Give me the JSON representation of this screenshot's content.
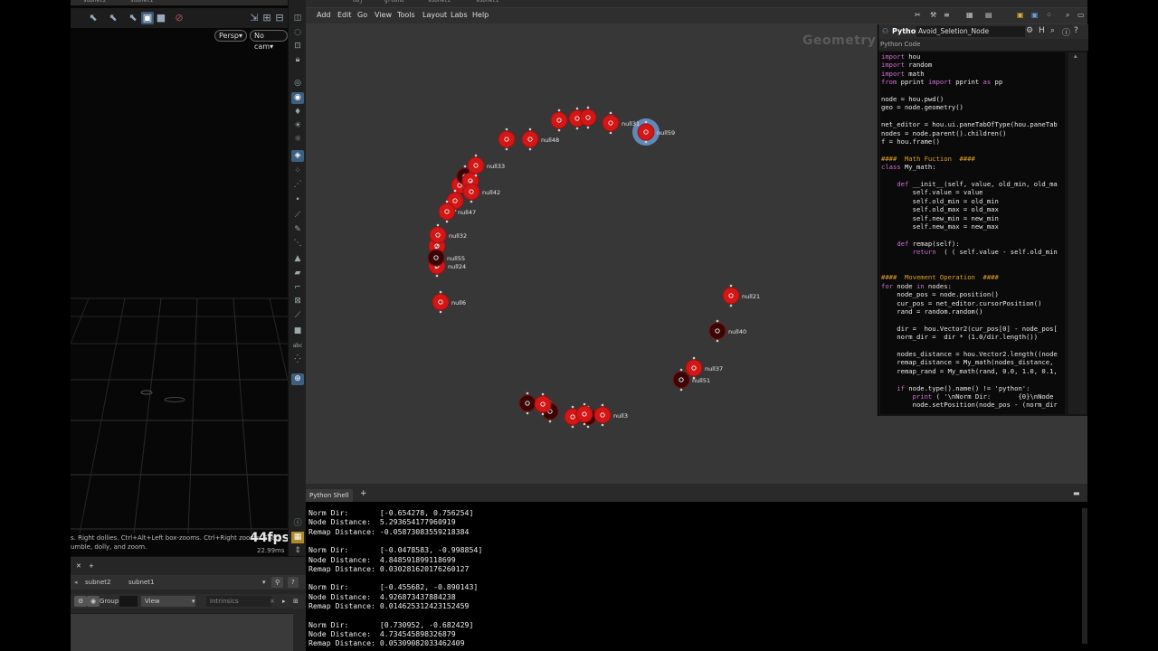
{
  "viewport": {
    "persp_label": "Persp▾",
    "cam_label": "No cam▾",
    "status_lines": [
      "s. Right dollies. Ctrl+Alt+Left box-zooms. Ctrl+Right zooms. Spac",
      "umble, dolly, and zoom."
    ],
    "fps": "44fps",
    "ms": "22.99ms"
  },
  "param_pane": {
    "path_items": [
      "subnet2",
      "subnet1"
    ],
    "group_label": "Group:",
    "view_label": "View",
    "intrinsics_label": "Intrinsics"
  },
  "top_paths": [
    "subnet2",
    "subnet1",
    "obj",
    "ground",
    "subnet2",
    "subnet1"
  ],
  "network": {
    "menu": [
      "Add",
      "Edit",
      "Go",
      "View",
      "Tools",
      "Layout",
      "Labs",
      "Help"
    ],
    "context_label": "Geometry",
    "nodes": [
      {
        "label": "null48"
      },
      {
        "label": "null59"
      },
      {
        "label": "null31"
      },
      {
        "label": "null33"
      },
      {
        "label": "null47"
      },
      {
        "label": "null32"
      },
      {
        "label": "null24"
      },
      {
        "label": "null6"
      },
      {
        "label": "null21"
      },
      {
        "label": "null40"
      },
      {
        "label": "null37"
      },
      {
        "label": "null51"
      },
      {
        "label": "null3"
      },
      {
        "label": "null55"
      },
      {
        "label": "null42"
      }
    ]
  },
  "code_panel": {
    "tab_label": "Python",
    "node_name": "Avoid_Seletion_Node",
    "sub_label": "Python Code",
    "lines": [
      "import hou",
      "import random",
      "import math",
      "from pprint import pprint as pp",
      "",
      "node = hou.pwd()",
      "geo = node.geometry()",
      "",
      "net_editor = hou.ui.paneTabOfType(hou.paneTab",
      "nodes = node.parent().children()",
      "f = hou.frame()",
      "",
      "####  Math Fuction  ####",
      "class My_math:",
      "",
      "    def __init__(self, value, old_min, old_ma",
      "        self.value = value",
      "        self.old_min = old_min",
      "        self.old_max = old_max",
      "        self.new_min = new_min",
      "        self.new_max = new_max",
      "",
      "    def remap(self):",
      "        return  ( ( self.value - self.old_min",
      "",
      "",
      "####  Movement Operation  ####",
      "for node in nodes:",
      "    node_pos = node.position()",
      "    cur_pos = net_editor.cursorPosition()",
      "    rand = random.random()",
      "",
      "    dir =  hou.Vector2(cur_pos[0] - node_pos[",
      "    norm_dir =  dir * (1.0/dir.length())",
      "",
      "    nodes_distance = hou.Vector2.length((node",
      "    remap_distance = My_math(nodes_distance,",
      "    remap_rand = My_math(rand, 0.0, 1.0, 0.1,",
      "",
      "    if node.type().name() != 'python':",
      "        print ( '\\nNorm Dir:       {0}\\nNode",
      "        node.setPosition(node_pos - (norm_dir"
    ]
  },
  "shell": {
    "tab_label": "Python Shell",
    "add_label": "+",
    "lines": [
      "Norm Dir:       [-0.654278, 0.756254]",
      "Node Distance:  5.293654177960919",
      "Remap Distance: -0.05873083559218384",
      "",
      "Norm Dir:       [-0.0478583, -0.998854]",
      "Node Distance:  4.848591899118699",
      "Remap Distance: 0.030281620176260127",
      "",
      "Norm Dir:       [-0.455682, -0.890143]",
      "Node Distance:  4.926873437884238",
      "Remap Distance: 0.014625312423152459",
      "",
      "Norm Dir:       [0.730952, -0.682429]",
      "Node Distance:  4.734545898326879",
      "Remap Distance: 0.05309082033462409"
    ]
  }
}
